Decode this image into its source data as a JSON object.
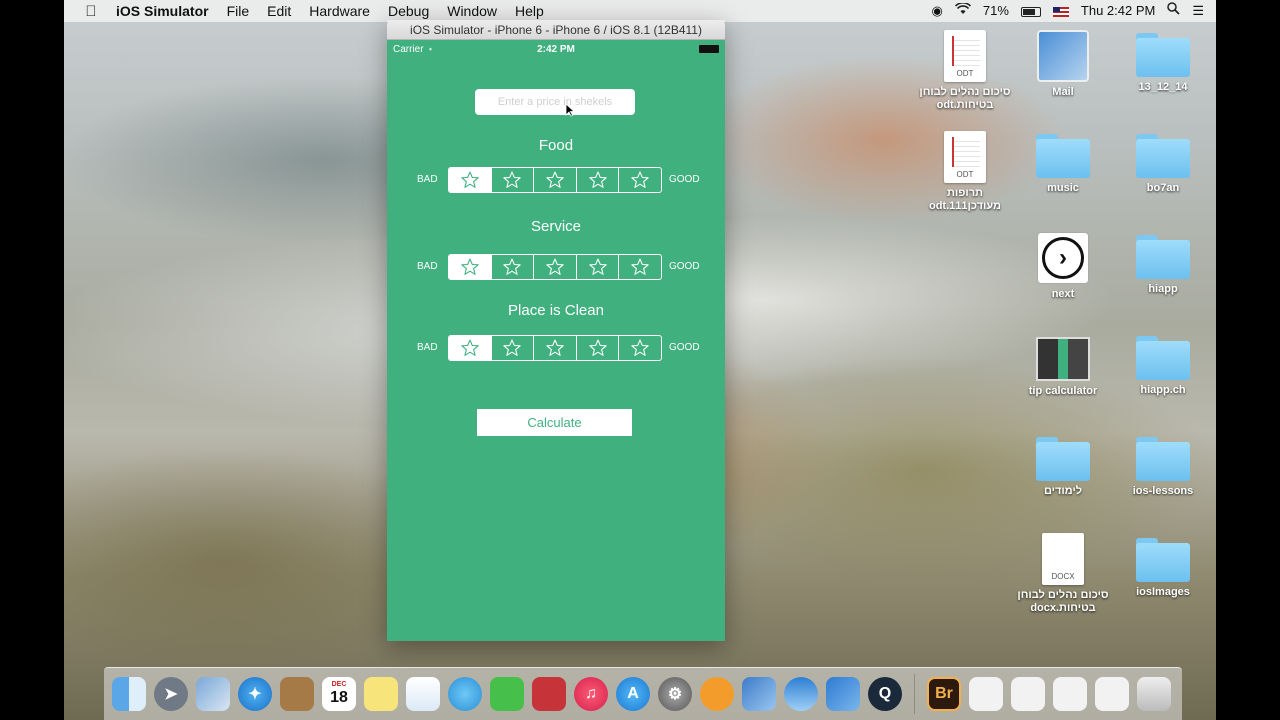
{
  "menubar": {
    "app_name": "iOS Simulator",
    "menus": [
      "File",
      "Edit",
      "Hardware",
      "Debug",
      "Window",
      "Help"
    ],
    "battery_percent": "71%",
    "clock": "Thu 2:42 PM"
  },
  "simulator": {
    "window_title": "iOS Simulator - iPhone 6 - iPhone 6 / iOS 8.1 (12B411)",
    "status": {
      "carrier": "Carrier",
      "time": "2:42 PM"
    },
    "input": {
      "placeholder": "Enter a price in shekels"
    },
    "ratings": [
      {
        "title": "Food",
        "bad_label": "BAD",
        "good_label": "GOOD",
        "selected": 1,
        "stars": 5
      },
      {
        "title": "Service",
        "bad_label": "BAD",
        "good_label": "GOOD",
        "selected": 1,
        "stars": 5
      },
      {
        "title": "Place is Clean",
        "bad_label": "BAD",
        "good_label": "GOOD",
        "selected": 1,
        "stars": 5
      }
    ],
    "calculate_label": "Calculate",
    "accent_color": "#3fb07e"
  },
  "desktop": {
    "icons": [
      {
        "label": "סיכום נהלים לבוחן בטיחות.odt",
        "kind": "document",
        "ext": "ODT"
      },
      {
        "label": "Mail",
        "kind": "app"
      },
      {
        "label": "13_12_14",
        "kind": "folder"
      },
      {
        "label": "תרופות מעודכן111.odt",
        "kind": "document",
        "ext": "ODT"
      },
      {
        "label": "music",
        "kind": "folder"
      },
      {
        "label": "bo7an",
        "kind": "folder"
      },
      {
        "label": "next",
        "kind": "app"
      },
      {
        "label": "hiapp",
        "kind": "folder"
      },
      {
        "label": "tip calculator",
        "kind": "app"
      },
      {
        "label": "hiapp.ch",
        "kind": "folder"
      },
      {
        "label": "לימודים",
        "kind": "folder"
      },
      {
        "label": "ios-lessons",
        "kind": "folder"
      },
      {
        "label": "סיכום נהלים לבוחן בטיחות.docx",
        "kind": "document",
        "ext": "DOCX"
      },
      {
        "label": "iosImages",
        "kind": "folder"
      }
    ]
  },
  "dock": {
    "calendar_month": "DEC",
    "calendar_day": "18",
    "bridge_label": "Br"
  }
}
